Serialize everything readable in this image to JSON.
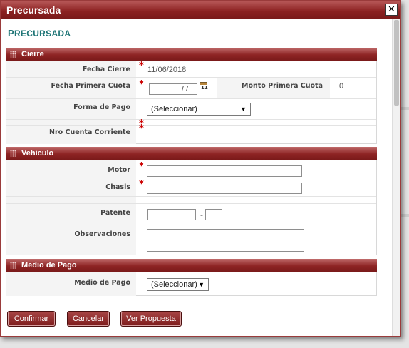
{
  "dialog": {
    "title": "Precursada",
    "close_label": "✕",
    "page_title_first": "P",
    "page_title_rest": "RECURSADA"
  },
  "cierre": {
    "header": "Cierre",
    "fecha_cierre_label": "Fecha Cierre",
    "fecha_cierre_value": "11/06/2018",
    "fecha_primera_cuota_label": "Fecha Primera Cuota",
    "fecha_primera_cuota_value": "  /  /",
    "calendar_day": "11",
    "monto_primera_cuota_label": "Monto Primera Cuota",
    "monto_primera_cuota_value": "0",
    "forma_pago_label": "Forma de Pago",
    "forma_pago_selected": "(Seleccionar)",
    "nro_cuenta_label": "Nro Cuenta Corriente",
    "required_mark": "*"
  },
  "vehiculo": {
    "header": "Vehículo",
    "motor_label": "Motor",
    "motor_value": "",
    "chasis_label": "Chasis",
    "chasis_value": "",
    "patente_label": "Patente",
    "patente_value_1": "",
    "patente_sep": "-",
    "patente_value_2": "",
    "observaciones_label": "Observaciones",
    "observaciones_value": ""
  },
  "medio_pago": {
    "header": "Medio de Pago",
    "label": "Medio de Pago",
    "selected": "(Seleccionar)"
  },
  "buttons": {
    "confirmar": "Confirmar",
    "cancelar": "Cancelar",
    "ver_propuesta": "Ver Propuesta"
  },
  "icons": {
    "dropdown": "▼",
    "calendar": "calendar-icon",
    "grip": "grip-icon"
  }
}
